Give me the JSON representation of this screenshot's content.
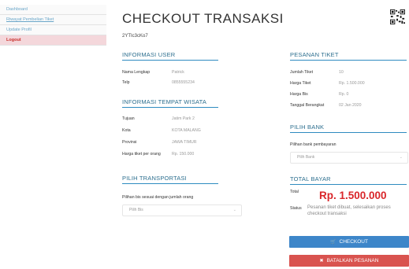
{
  "sidebar": {
    "items": [
      {
        "label": "Dashboard"
      },
      {
        "label": "Riwayat Pembelian Tiket"
      },
      {
        "label": "Update Profil"
      },
      {
        "label": "Logout"
      }
    ]
  },
  "page": {
    "title": "CHECKOUT TRANSAKSI",
    "code": "2YTIc3cKo7"
  },
  "user_info": {
    "heading": "INFORMASI USER",
    "name_label": "Nama Lengkap",
    "name_value": "Patrick",
    "phone_label": "Telp",
    "phone_value": "0855555234"
  },
  "place_info": {
    "heading": "INFORMASI TEMPAT WISATA",
    "dest_label": "Tujuan",
    "dest_value": "Jatim Park 2",
    "city_label": "Kota",
    "city_value": "KOTA MALANG",
    "prov_label": "Provinsi",
    "prov_value": "JAWA TIMUR",
    "price_label": "Harga tiket per orang",
    "price_value": "Rp. 150.000"
  },
  "transport": {
    "heading": "PILIH TRANSPORTASI",
    "select_label": "Pilihan bis sesuai dengan jumlah orang",
    "select_value": "Pilih Bis"
  },
  "order": {
    "heading": "PESANAN TIKET",
    "qty_label": "Jumlah Tiket",
    "qty_value": "10",
    "ticket_price_label": "Harga Tiket",
    "ticket_price_value": "Rp. 1.500.000",
    "bus_price_label": "Harga Bis",
    "bus_price_value": "Rp. 0",
    "date_label": "Tanggal Berangkat",
    "date_value": "02 Jan 2020"
  },
  "bank": {
    "heading": "PILIH BANK",
    "select_label": "Pilihan bank pembayaran",
    "select_value": "Pilih Bank"
  },
  "total": {
    "heading": "TOTAL BAYAR",
    "total_label": "Total",
    "total_value": "Rp. 1.500.000",
    "status_label": "Status",
    "status_value": "Pesanan tiket dibuat, selesaikan proses checkout transaksi"
  },
  "buttons": {
    "checkout": "CHECKOUT",
    "cancel": "BATALKAN PESANAN"
  },
  "colors": {
    "accent": "#3d86c9",
    "danger": "#d9534f",
    "price": "#d9262a"
  }
}
